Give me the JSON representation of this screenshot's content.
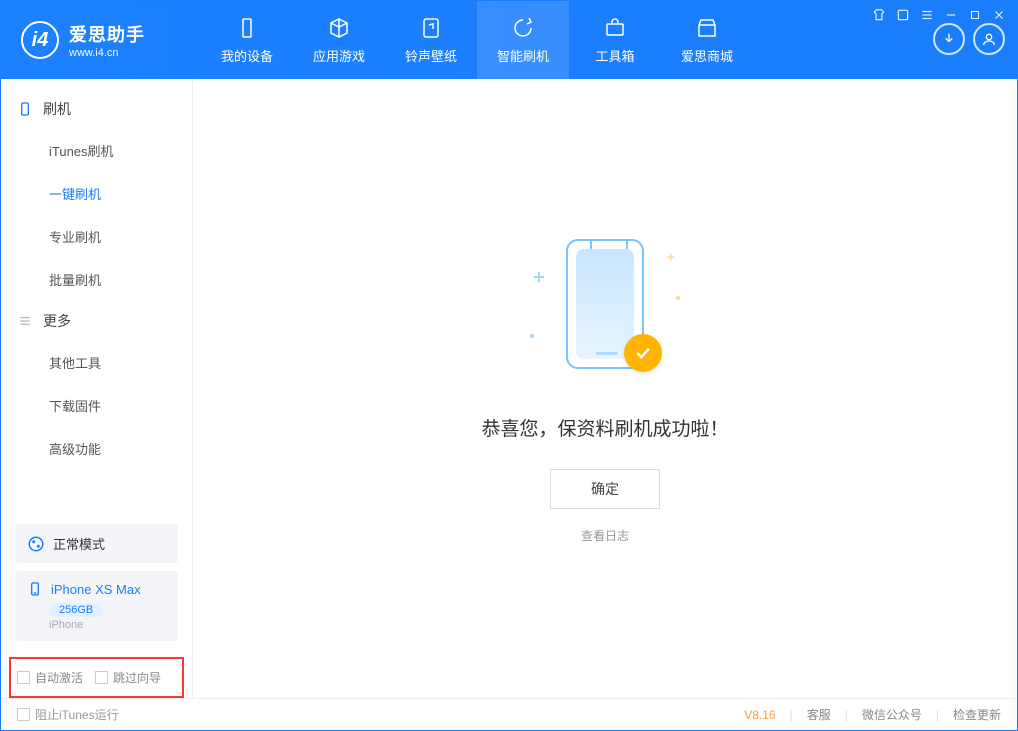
{
  "logo": {
    "zh": "爱思助手",
    "en": "www.i4.cn",
    "icon_letter": "i4"
  },
  "nav": [
    {
      "label": "我的设备",
      "icon": "device"
    },
    {
      "label": "应用游戏",
      "icon": "cube"
    },
    {
      "label": "铃声壁纸",
      "icon": "music"
    },
    {
      "label": "智能刷机",
      "icon": "refresh",
      "active": true
    },
    {
      "label": "工具箱",
      "icon": "toolbox"
    },
    {
      "label": "爱思商城",
      "icon": "store"
    }
  ],
  "sidebar": {
    "section1": {
      "title": "刷机",
      "items": [
        "iTunes刷机",
        "一键刷机",
        "专业刷机",
        "批量刷机"
      ],
      "selected_index": 1
    },
    "section2": {
      "title": "更多",
      "items": [
        "其他工具",
        "下载固件",
        "高级功能"
      ]
    },
    "mode": "正常模式",
    "device": {
      "name": "iPhone XS Max",
      "storage": "256GB",
      "type": "iPhone"
    },
    "options": {
      "auto_activate": "自动激活",
      "skip_guide": "跳过向导"
    }
  },
  "main": {
    "success_text": "恭喜您，保资料刷机成功啦！",
    "ok_button": "确定",
    "log_link": "查看日志"
  },
  "footer": {
    "block_itunes": "阻止iTunes运行",
    "version": "V8.16",
    "support": "客服",
    "wechat": "微信公众号",
    "update": "检查更新"
  },
  "title_buttons": [
    "shirt",
    "book",
    "menu",
    "min",
    "max",
    "close"
  ]
}
